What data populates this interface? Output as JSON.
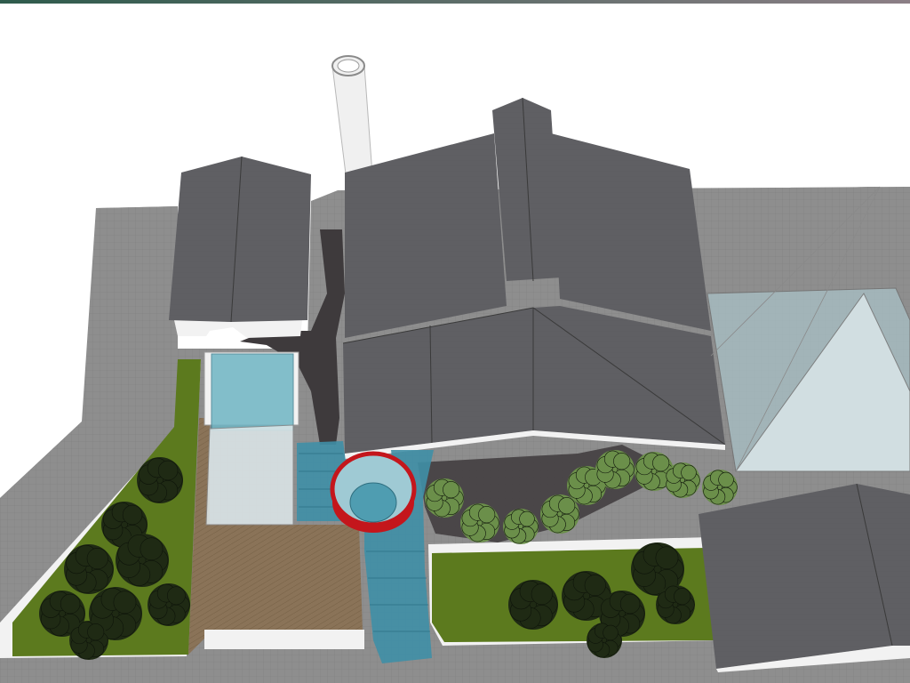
{
  "scene": {
    "kind": "3d-site-model",
    "colors": {
      "background": "#ffffff",
      "paving": "#8e8e8e",
      "roof": "#5f5f63",
      "roof_dark": "#4e4e52",
      "wall": "#f2f2f2",
      "grass": "#5c7a1e",
      "deck": "#8a7358",
      "glass": "#6fb5c4",
      "water_path": "#3f8fa6",
      "red_ring": "#c4161c",
      "path_dark": "#3e3a3c",
      "tree": "#1f2a14",
      "shrub": "#6b8f4a",
      "chimney": "#f0f0f0",
      "top_gradient_left": "#2e5b4c",
      "top_gradient_right": "#8c7f86"
    },
    "objects": [
      "chimney",
      "left-house",
      "main-house",
      "glass-pyramid",
      "lower-right-house",
      "glass-cube",
      "red-fountain-ring",
      "water-walkway",
      "wood-deck",
      "left-lawn",
      "right-lawn",
      "shrub-row",
      "left-trees",
      "right-trees"
    ]
  }
}
